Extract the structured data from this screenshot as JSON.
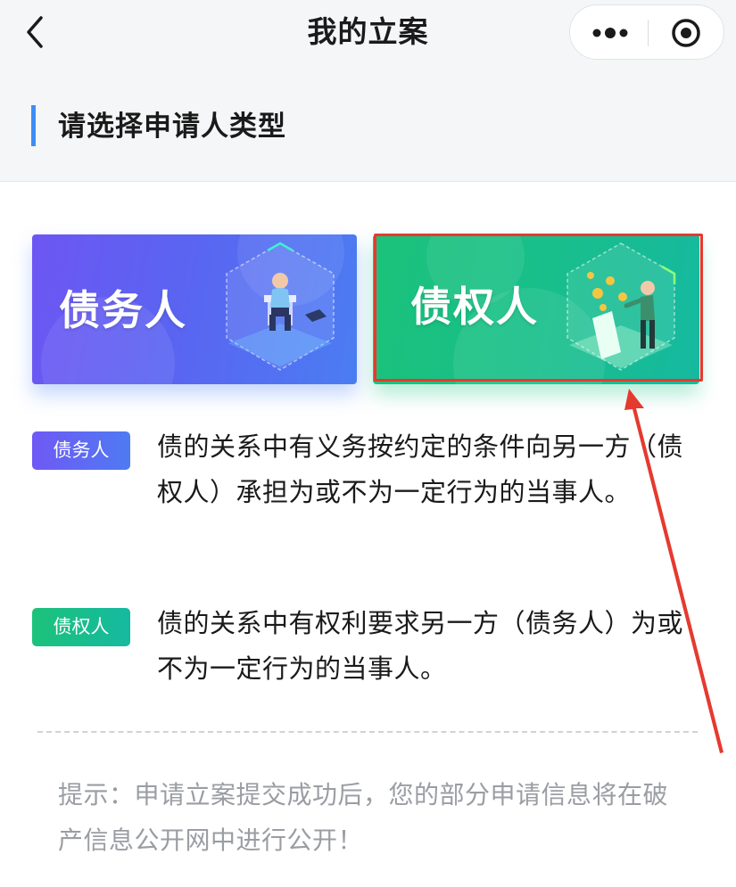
{
  "navbar": {
    "title": "我的立案",
    "back_icon": "chevron-left-icon",
    "more_icon": "more-dots-icon",
    "close_icon": "target-close-icon"
  },
  "section": {
    "title": "请选择申请人类型",
    "accent_color": "#3d8ef7"
  },
  "cards": [
    {
      "label": "债务人",
      "illustration_icon": "sitting-person-icon",
      "color": "#5a64f1",
      "selected": false
    },
    {
      "label": "债权人",
      "illustration_icon": "coins-person-icon",
      "color": "#18bf8a",
      "selected": true
    }
  ],
  "definitions": [
    {
      "badge": "债务人",
      "text": "债的关系中有义务按约定的条件向另一方（债权人）承担为或不为一定行为的当事人。"
    },
    {
      "badge": "债权人",
      "text": "债的关系中有权利要求另一方（债务人）为或不为一定行为的当事人。"
    }
  ],
  "tip": "提示：申请立案提交成功后，您的部分申请信息将在破产信息公开网中进行公开！",
  "annotation": {
    "color": "#e53a2f"
  }
}
